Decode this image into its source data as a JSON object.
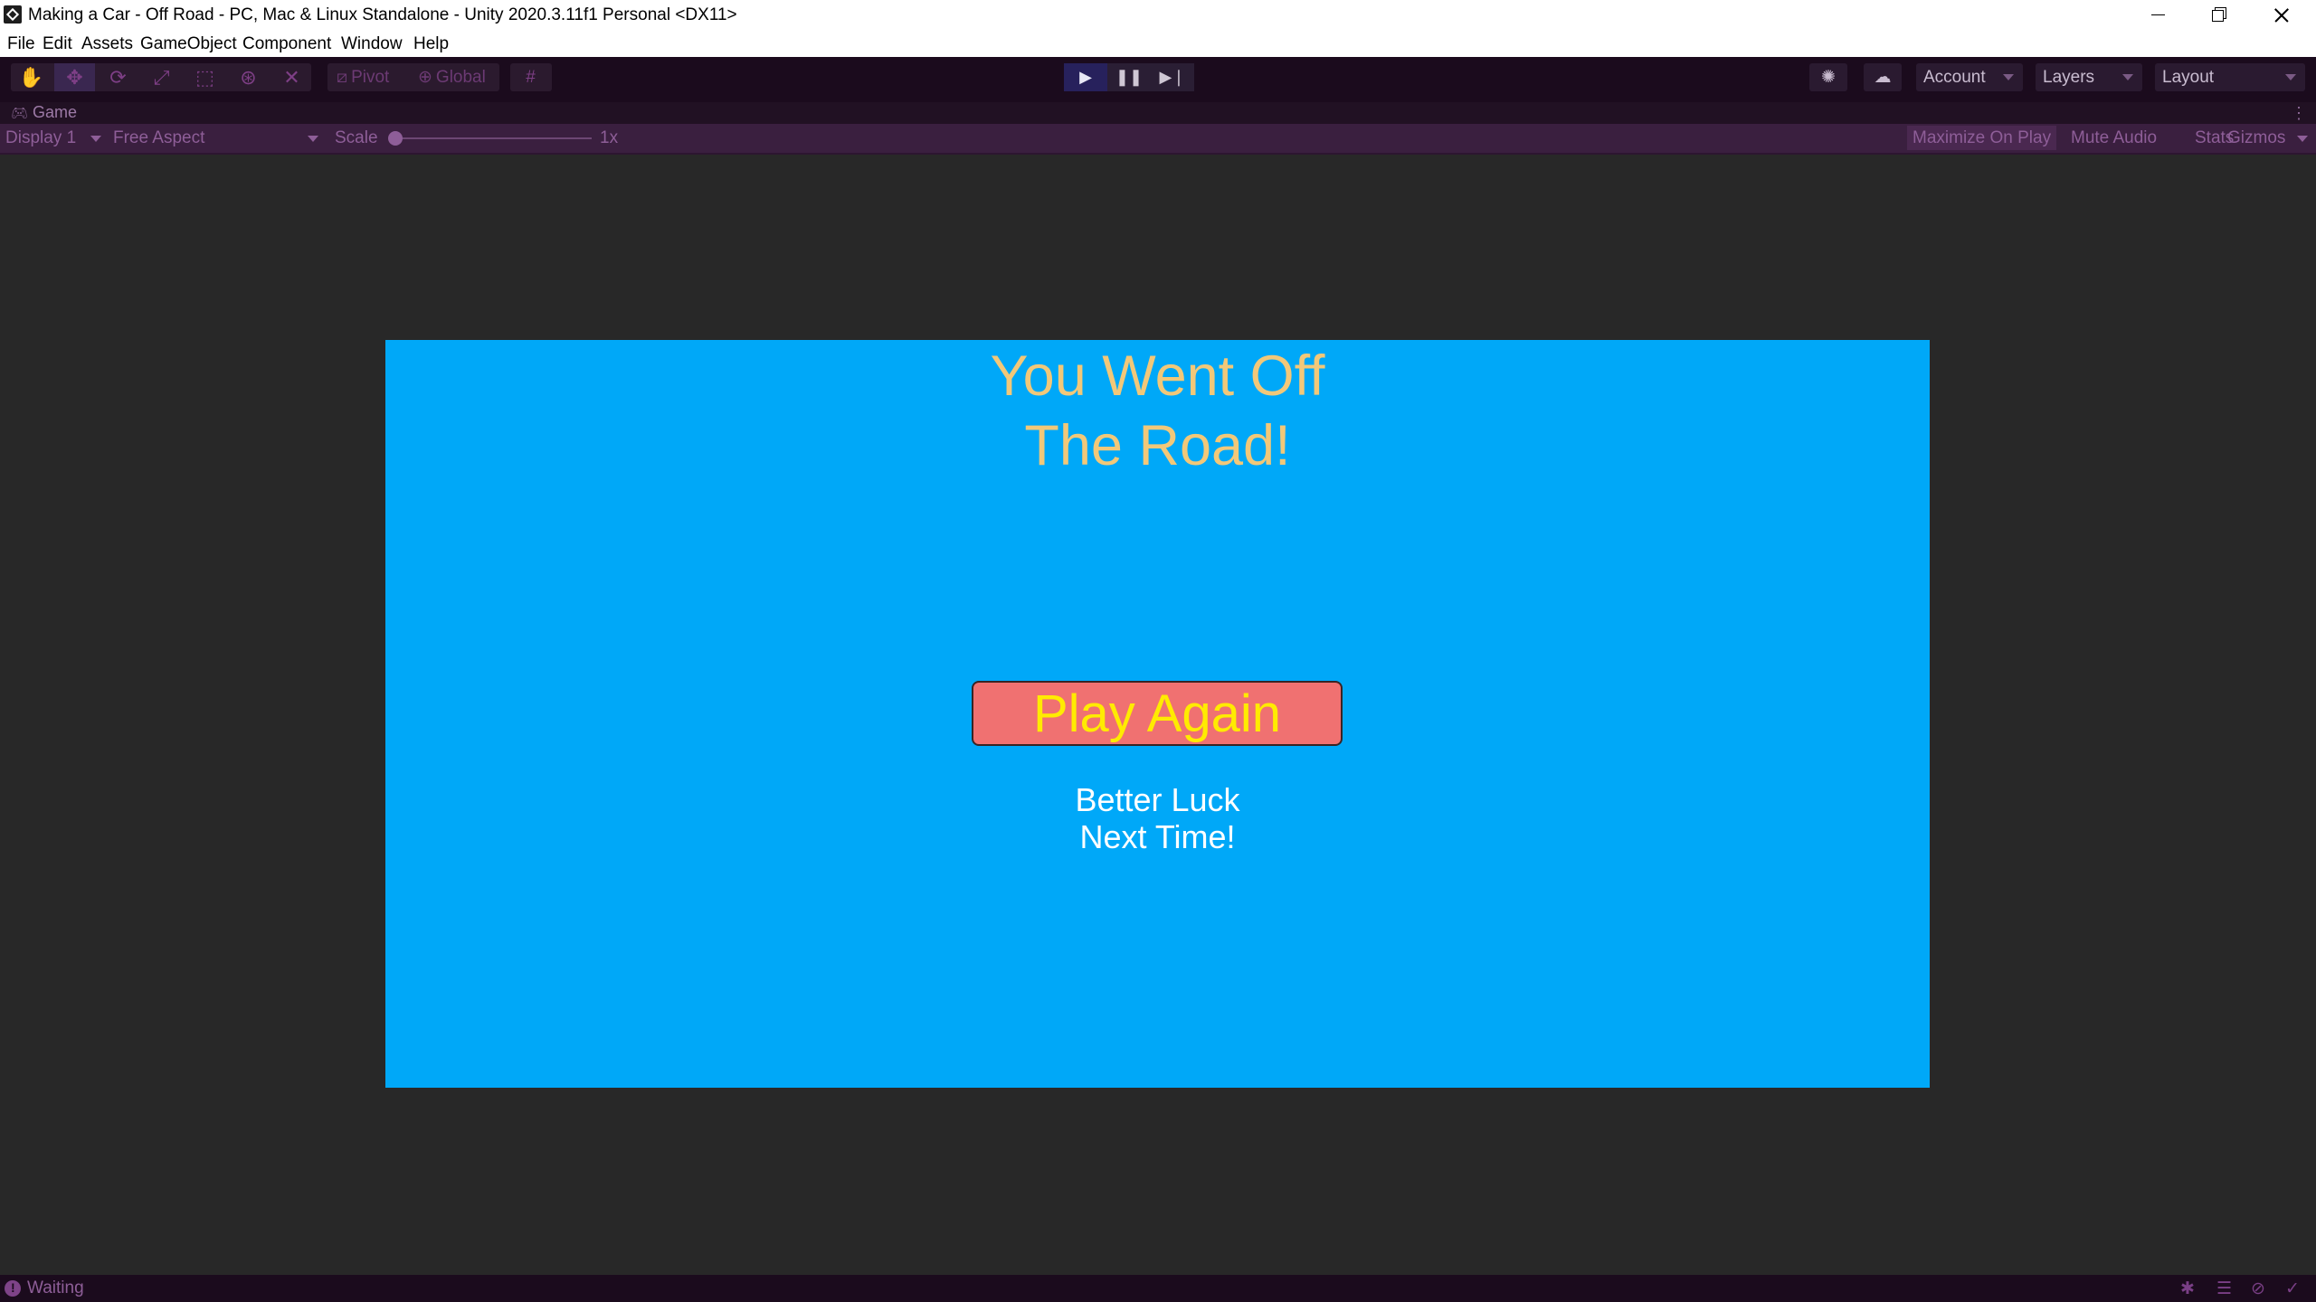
{
  "window": {
    "title": "Making a Car - Off Road - PC, Mac & Linux Standalone - Unity 2020.3.11f1 Personal <DX11>"
  },
  "menu": [
    "File",
    "Edit",
    "Assets",
    "GameObject",
    "Component",
    "Window",
    "Help"
  ],
  "toolbar": {
    "tools": [
      "hand-icon",
      "move-icon",
      "rotate-icon",
      "scale-icon",
      "rect-icon",
      "transform-icon",
      "custom-tool-icon"
    ],
    "pivot_label": "Pivot",
    "global_label": "Global",
    "account_label": "Account",
    "layers_label": "Layers",
    "layout_label": "Layout"
  },
  "tab": {
    "label": "Game"
  },
  "gamebar": {
    "display": "Display 1",
    "aspect": "Free Aspect",
    "scale_label": "Scale",
    "scale_value": "1x",
    "maximize": "Maximize On Play",
    "mute": "Mute Audio",
    "stats": "Stats",
    "gizmos": "Gizmos"
  },
  "game": {
    "title_line1": "You Went Off",
    "title_line2": "The Road!",
    "button_label": "Play Again",
    "sub_line1": "Better Luck",
    "sub_line2": "Next Time!"
  },
  "status": {
    "text": "Waiting"
  },
  "colors": {
    "game_background": "#00a8f8",
    "title_text": "#f2c879",
    "button_background": "#f07171",
    "button_text": "#ffeb00",
    "toolbar_background": "#1b0b1d",
    "accent": "#8e5e98"
  }
}
